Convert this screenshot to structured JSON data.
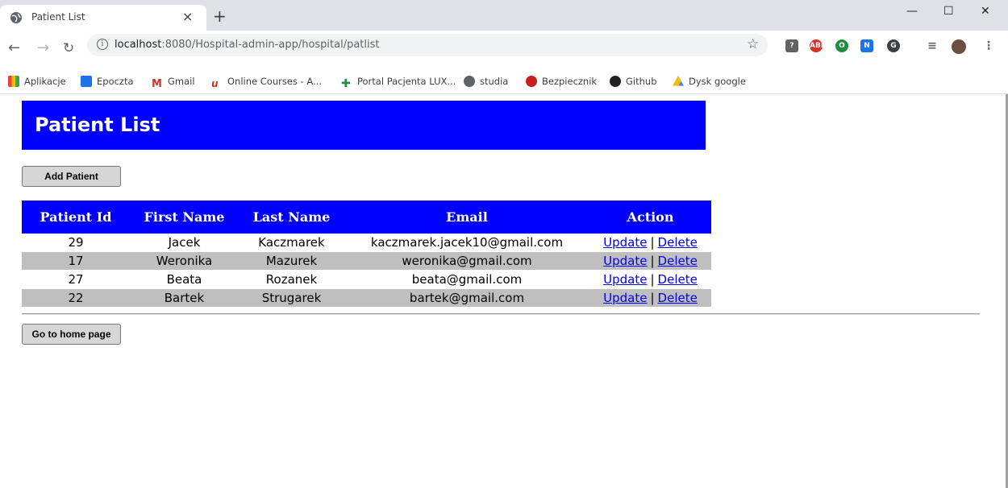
{
  "browser": {
    "tab_title": "Patient List",
    "tab_close": "×",
    "new_tab": "+",
    "url_host": "localhost",
    "url_path": ":8080/Hospital-admin-app/hospital/patlist",
    "window_minimize": "—",
    "window_maximize": "☐",
    "window_close": "✕",
    "bookmarks": [
      {
        "label": "Aplikacje",
        "icon": "apps-grid-icon",
        "color": "#e8453c"
      },
      {
        "label": "Epoczta",
        "icon": "epoczta-icon",
        "color": "#1a73e8"
      },
      {
        "label": "Gmail",
        "icon": "gmail-icon",
        "color": "#d93025"
      },
      {
        "label": "Online Courses - A...",
        "icon": "online-courses-icon",
        "color": "#d93025"
      },
      {
        "label": "Portal Pacjenta LUX...",
        "icon": "portal-pacjenta-icon",
        "color": "#1e8e3e"
      },
      {
        "label": "studia",
        "icon": "globe-icon",
        "color": "#5f6368"
      },
      {
        "label": "Bezpiecznik",
        "icon": "bezpiecznik-icon",
        "color": "#c5221f"
      },
      {
        "label": "Github",
        "icon": "github-icon",
        "color": "#202124"
      },
      {
        "label": "Dysk google",
        "icon": "google-drive-icon",
        "color": "#fbbc04"
      }
    ]
  },
  "page": {
    "title": "Patient List",
    "add_button": "Add Patient",
    "home_button": "Go to home page",
    "table": {
      "headers": [
        "Patient Id",
        "First Name",
        "Last Name",
        "Email",
        "Action"
      ],
      "rows": [
        {
          "id": "29",
          "first": "Jacek",
          "last": "Kaczmarek",
          "email": "kaczmarek.jacek10@gmail.com"
        },
        {
          "id": "17",
          "first": "Weronika",
          "last": "Mazurek",
          "email": "weronika@gmail.com"
        },
        {
          "id": "27",
          "first": "Beata",
          "last": "Rozanek",
          "email": "beata@gmail.com"
        },
        {
          "id": "22",
          "first": "Bartek",
          "last": "Strugarek",
          "email": "bartek@gmail.com"
        }
      ],
      "update_label": "Update",
      "delete_label": "Delete",
      "separator": "|"
    }
  },
  "colors": {
    "header_blue": "#0000ff",
    "row_alt": "#bfbfbf",
    "link": "#0000ee"
  }
}
